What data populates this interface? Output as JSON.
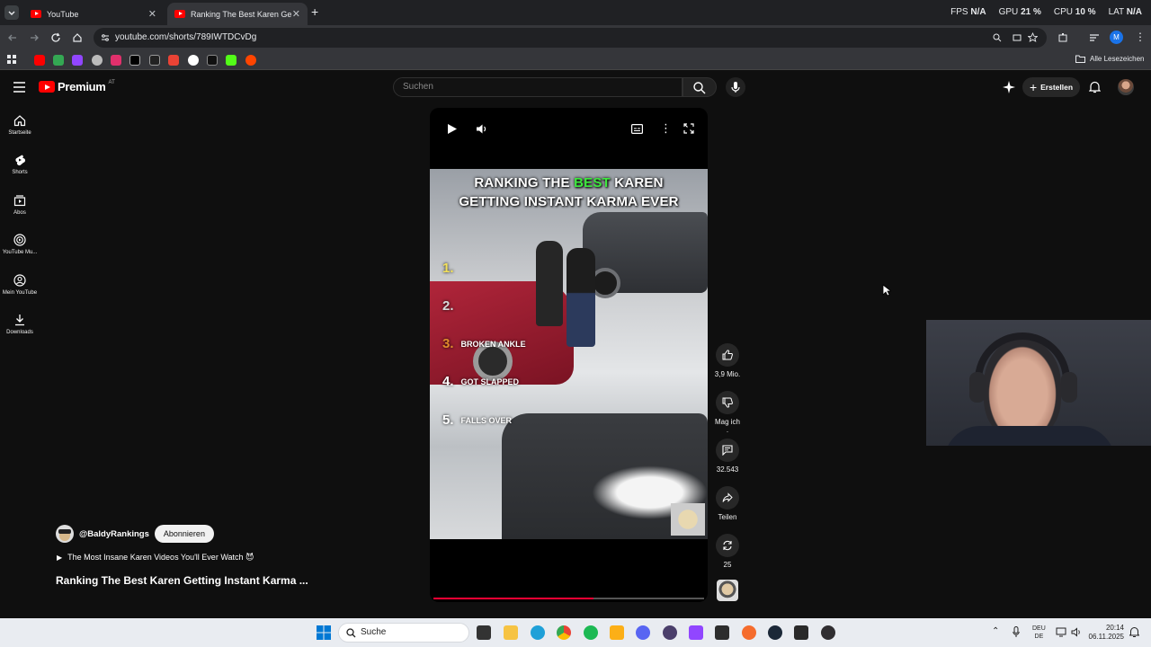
{
  "browser": {
    "tabs": [
      {
        "title": "YouTube",
        "active": false
      },
      {
        "title": "Ranking The Best Karen Getting",
        "active": true
      }
    ],
    "stats": [
      {
        "label": "FPS",
        "value": "N/A"
      },
      {
        "label": "GPU",
        "value": "21 %"
      },
      {
        "label": "CPU",
        "value": "10 %"
      },
      {
        "label": "LAT",
        "value": "N/A"
      }
    ],
    "url": "youtube.com/shorts/789IWTDCvDg",
    "profile_letter": "M",
    "bookmarks_folder": "Alle Lesezeichen"
  },
  "youtube": {
    "logo": "Premium",
    "region": "AT",
    "search_placeholder": "Suchen",
    "create_label": "Erstellen",
    "sidebar": [
      {
        "label": "Startseite",
        "icon": "home-icon"
      },
      {
        "label": "Shorts",
        "icon": "shorts-icon"
      },
      {
        "label": "Abos",
        "icon": "subscriptions-icon"
      },
      {
        "label": "YouTube Mu...",
        "icon": "youtube-music-icon"
      },
      {
        "label": "Mein YouTube",
        "icon": "account-icon"
      },
      {
        "label": "Downloads",
        "icon": "download-icon"
      }
    ],
    "video": {
      "headline_1_a": "RANKING THE ",
      "headline_1_b": "BEST",
      "headline_1_c": " KAREN",
      "headline_2": "GETTING INSTANT KARMA EVER",
      "ranks": [
        {
          "num": "1.",
          "label": "",
          "color": "#f2e05a"
        },
        {
          "num": "2.",
          "label": "",
          "color": "#d8d8d8"
        },
        {
          "num": "3.",
          "label": "BROKEN ANKLE",
          "color": "#e08a2c"
        },
        {
          "num": "4.",
          "label": "GOT SLAPPED",
          "color": "#ffffff"
        },
        {
          "num": "5.",
          "label": "FALLS OVER",
          "color": "#ffffff"
        }
      ],
      "progress": 0.59
    },
    "actions": {
      "likes": "3,9 Mio.",
      "dislike_label": "Mag ich .",
      "comments": "32.543",
      "share_label": "Teilen",
      "remix_count": "25"
    },
    "channel": {
      "handle": "@BaldyRankings",
      "subscribe_label": "Abonnieren"
    },
    "playlist_label": "The Most Insane Karen Videos You'll Ever Watch 😈",
    "video_title": "Ranking The Best Karen Getting Instant Karma ..."
  },
  "taskbar": {
    "search_label": "Suche",
    "lang_1": "DEU",
    "lang_2": "DE",
    "time": "20:14",
    "date": "06.11.2025"
  },
  "colors": {
    "youtube_red": "#ff0000",
    "accent_green": "#3ee83e",
    "progress_red": "#ff0033"
  }
}
